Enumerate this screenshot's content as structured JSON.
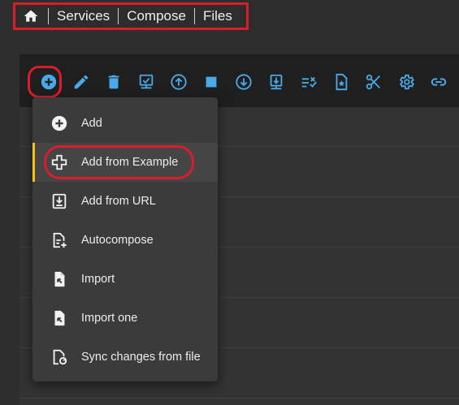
{
  "breadcrumb": {
    "home_icon": "home-icon",
    "items": [
      "Services",
      "Compose",
      "Files"
    ]
  },
  "toolbar": {
    "icons": [
      "add-circle-icon",
      "pencil-icon",
      "trash-icon",
      "monitor-check-icon",
      "arrow-up-circle-icon",
      "stop-icon",
      "arrow-down-circle-icon",
      "download-tray-icon",
      "list-check-icon",
      "file-star-icon",
      "scissors-icon",
      "gear-icon",
      "link-icon"
    ],
    "accent_color": "#4aa9e6"
  },
  "menu": {
    "items": [
      {
        "label": "Add",
        "icon": "plus-circle-icon"
      },
      {
        "label": "Add from Example",
        "icon": "plus-outline-icon"
      },
      {
        "label": "Add from URL",
        "icon": "download-file-icon"
      },
      {
        "label": "Autocompose",
        "icon": "file-plus-icon"
      },
      {
        "label": "Import",
        "icon": "file-import-icon"
      },
      {
        "label": "Import one",
        "icon": "file-import-one-icon"
      },
      {
        "label": "Sync changes from file",
        "icon": "file-sync-icon"
      }
    ],
    "selected_index": 1,
    "selected_color": "#f0c419"
  },
  "highlight_color": "#d81e2a"
}
